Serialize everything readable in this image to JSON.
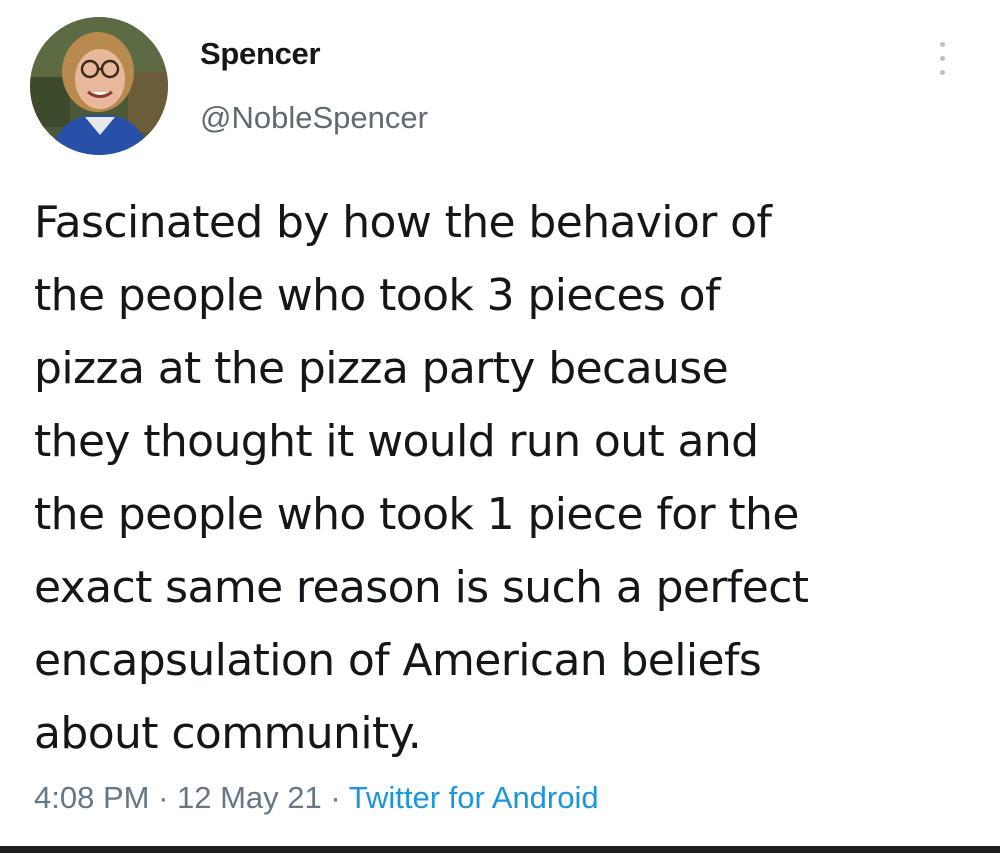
{
  "tweet": {
    "author": {
      "display_name": "Spencer",
      "handle": "@NobleSpencer",
      "avatar_icon": "profile-photo"
    },
    "more_icon": "more-vertical-icon",
    "text_lines": [
      "Fascinated by how the behavior of",
      "the people who took 3 pieces of",
      "pizza at the pizza party because",
      "they thought it would run out and",
      "the people who took 1 piece for the",
      "exact same reason is such a perfect",
      "encapsulation of American beliefs",
      "about community."
    ],
    "meta": {
      "time": "4:08 PM",
      "separator": " · ",
      "date": "12 May 21",
      "source": "Twitter for Android"
    }
  },
  "colors": {
    "text": "#14171a",
    "secondary": "#657786",
    "link": "#1b95e0",
    "background": "#ffffff"
  }
}
